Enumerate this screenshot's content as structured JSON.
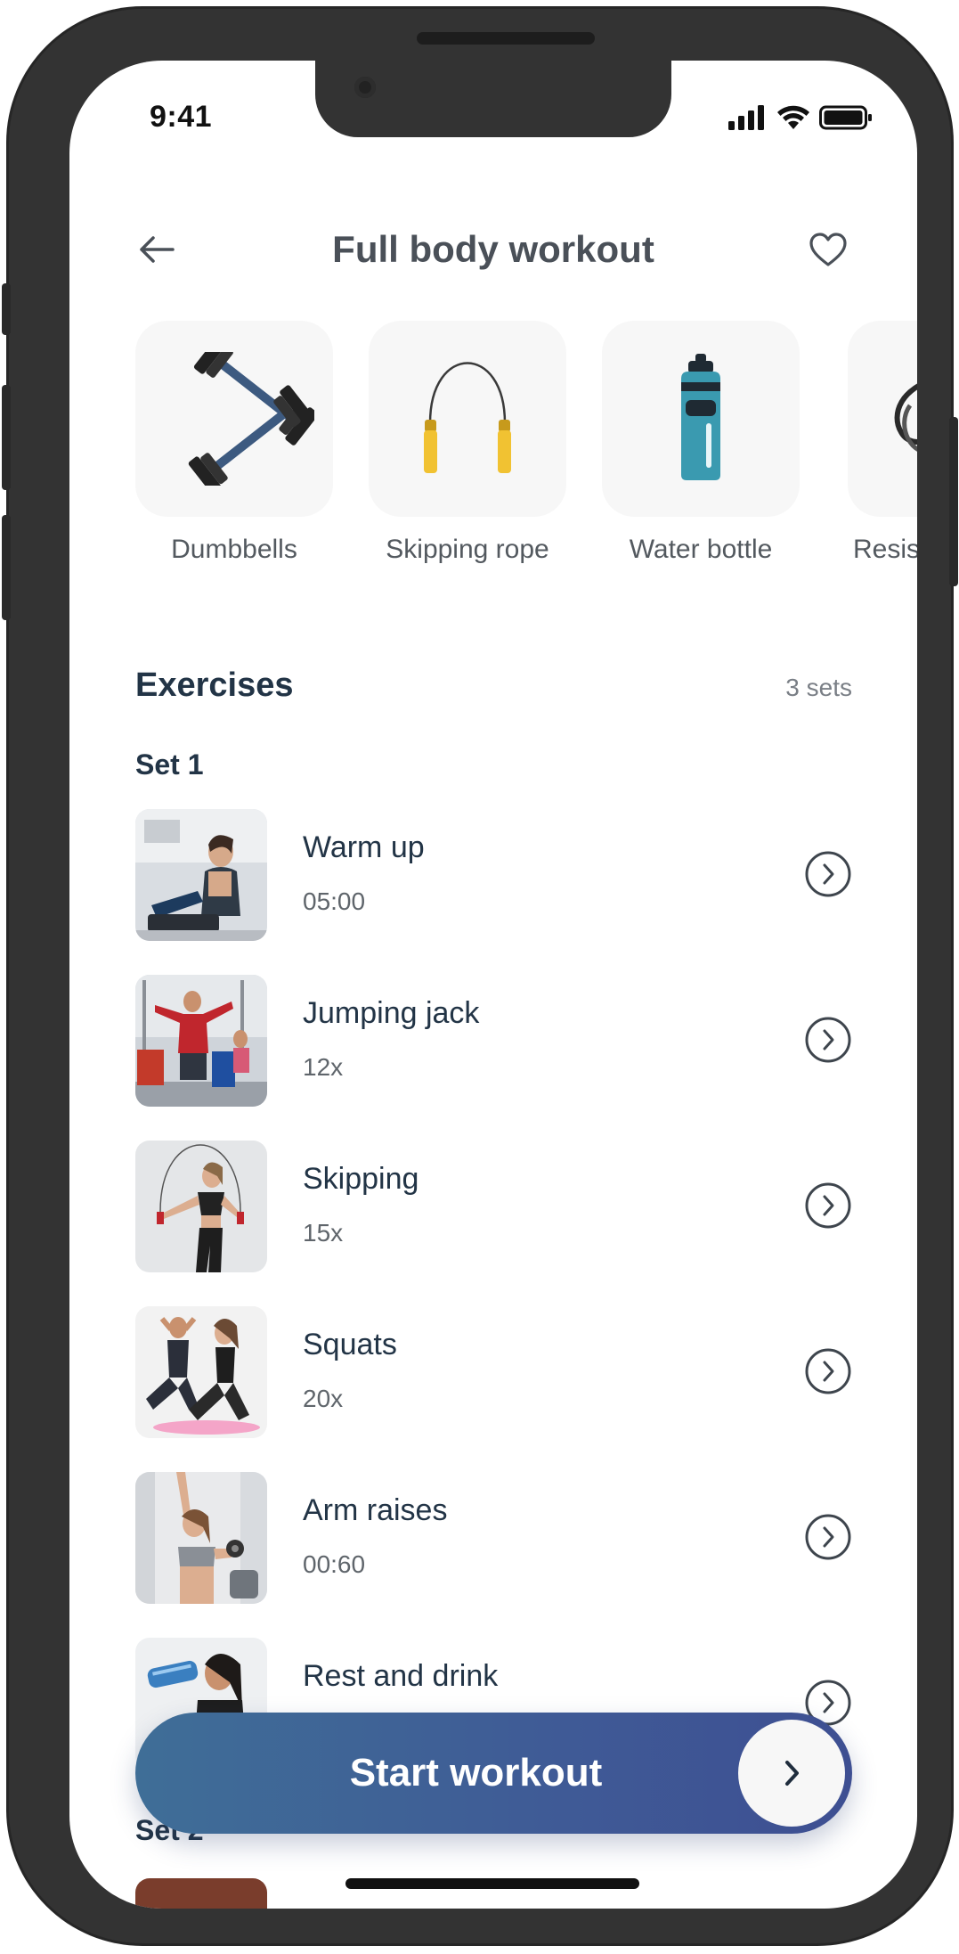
{
  "status_bar": {
    "time": "9:41"
  },
  "header": {
    "title": "Full body workout"
  },
  "equipment": [
    {
      "label": "Dumbbells",
      "icon": "dumbbells-icon"
    },
    {
      "label": "Skipping rope",
      "icon": "skipping-rope-icon"
    },
    {
      "label": "Water bottle",
      "icon": "water-bottle-icon"
    },
    {
      "label": "Resistance band",
      "icon": "resistance-band-icon"
    }
  ],
  "exercises": {
    "title": "Exercises",
    "sets_count": "3 sets",
    "sets": [
      {
        "label": "Set 1",
        "items": [
          {
            "name": "Warm up",
            "value": "05:00"
          },
          {
            "name": "Jumping jack",
            "value": "12x"
          },
          {
            "name": "Skipping",
            "value": "15x"
          },
          {
            "name": "Squats",
            "value": "20x"
          },
          {
            "name": "Arm raises",
            "value": "00:60"
          },
          {
            "name": "Rest and drink",
            "value": ""
          }
        ]
      },
      {
        "label": "Set 2",
        "items": []
      }
    ]
  },
  "cta": {
    "label": "Start workout"
  },
  "colors": {
    "accent": "#3f5a96",
    "text_dark": "#223446",
    "tile_bg": "#f7f7f7",
    "frame": "#333333"
  }
}
